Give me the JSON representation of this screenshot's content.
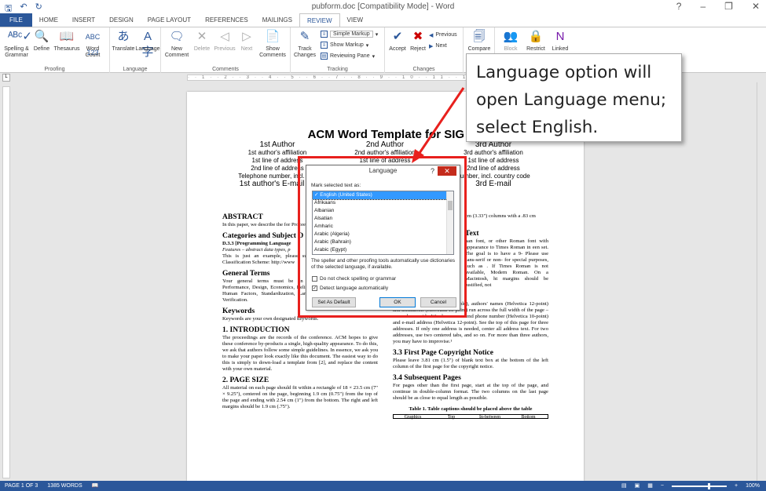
{
  "window": {
    "title": "pubform.doc [Compatibility Mode] - Word",
    "controls": [
      "?",
      "–",
      "❐",
      "✕"
    ]
  },
  "quick_access": {
    "save_icon": "save-icon",
    "undo_icon": "undo-icon",
    "redo_icon": "redo-icon"
  },
  "tabs": [
    "FILE",
    "HOME",
    "INSERT",
    "DESIGN",
    "PAGE LAYOUT",
    "REFERENCES",
    "MAILINGS",
    "REVIEW",
    "VIEW"
  ],
  "active_tab": "REVIEW",
  "ribbon": {
    "proofing": {
      "label": "Proofing",
      "spelling": "Spelling &\nGrammar",
      "define": "Define",
      "thesaurus": "Thesaurus",
      "word_count": "Word\nCount"
    },
    "language": {
      "label": "Language",
      "translate": "Translate",
      "language": "Language"
    },
    "comments": {
      "label": "Comments",
      "new": "New\nComment",
      "delete": "Delete",
      "previous": "Previous",
      "next": "Next",
      "show": "Show\nComments"
    },
    "tracking": {
      "label": "Tracking",
      "track": "Track\nChanges",
      "markup": "Simple Markup",
      "show_markup": "Show Markup",
      "reviewing_pane": "Reviewing Pane"
    },
    "changes": {
      "label": "Changes",
      "accept": "Accept",
      "reject": "Reject",
      "previous": "Previous",
      "next": "Next"
    },
    "compare": {
      "label": "Compare"
    },
    "protect": {
      "block": "Block",
      "restrict": "Restrict"
    },
    "onenote": {
      "linked": "Linked"
    }
  },
  "document": {
    "title": "ACM Word Template for SIG Si",
    "authors": [
      {
        "name": "1st Author",
        "lines": [
          "1st author's affiliation",
          "1st line of address",
          "2nd line of address",
          "Telephone number, incl. cou"
        ],
        "email": "1st author's E-mail ad"
      },
      {
        "name": "2nd Author",
        "lines": [
          "2nd author's affiliation",
          "1st line of address",
          "",
          ""
        ],
        "email": ""
      },
      {
        "name": "3rd Author",
        "lines": [
          "3rd author's affiliation",
          "1st line of address",
          "2nd line of address",
          "number, incl. country code"
        ],
        "email": "3rd E-mail"
      }
    ],
    "left_col": {
      "abstract_h": "ABSTRACT",
      "abstract_p": "In this paper, we describe the for Proceedings.",
      "cat_h": "Categories and Subject D",
      "cat_p1": "D.3.3 [Programming Language",
      "cat_p2": "Features – abstract data types, p",
      "cat_p3": "This is just an example, please subject descriptors for your sub Classification Scheme: http://www",
      "gen_h": "General Terms",
      "gen_p": "Your general terms must be an terms: Algorithms, Manageme Performance, Design, Economics, Reliability, Experimentation, Security, Human Factors, Standardization, Languages, Theory, Legal Aspects, Verification.",
      "kw_h": "Keywords",
      "kw_p": "Keywords are your own designated keywords.",
      "intro_h": "1.  INTRODUCTION",
      "intro_p": "The proceedings are the records of the conference. ACM hopes to give these conference by-products a single, high-quality appearance. To do this, we ask that authors follow some simple guidelines. In essence, we ask you to make your paper look exactly like this document. The easiest way to do this is simply to down-load a template from [2], and replace the content with your own material.",
      "size_h": "2.  PAGE SIZE",
      "size_p": "All material on each page should fit within a rectangle of 18 × 23.5 cm (7\" × 9.25\"), centered on the page, beginning 1.9 cm (0.75\") from the top of the page and ending with 2.54 cm (1\") from the bottom. The right and left margins should be 1.9 cm (.75\")."
    },
    "right_col": {
      "frag1": "cm (3.33\") columns with a .83 cm",
      "frag_h": "Text",
      "frag2": "nan font, or other Roman font with appearance to Times Roman in een set. The goal is to have a 9- Please use sans-serif or non- for special purposes, such as . If Times Roman is not available, Modern Roman. On a Macintosh, ht margins should be justified, not",
      "s32_h": "3.2  Title and Authors",
      "s32_p": "The title (Helvetica 18-point bold), authors' names (Helvetica 12-point) and affiliations (Helvetica 10-point) run across the full width of the page – one column wide. We also recommend phone number (Helvetica 10-point) and e-mail address (Helvetica 12-point). See the top of this page for three addresses. If only one address is needed, center all address text. For two addresses, use two centered tabs, and so on. For more than three authors, you may have to improvise.¹",
      "s33_h": "3.3  First Page Copyright Notice",
      "s33_p": "Please leave 3.81 cm (1.5\") of blank text box at the bottom of the left column of the first page for the copyright notice.",
      "s34_h": "3.4  Subsequent Pages",
      "s34_p": "For pages other than the first page, start at the top of the page, and continue in double-column format.  The two columns on the last page should be as close to equal length as possible.",
      "caption": "Table 1. Table captions should be placed above the table",
      "table_headers": [
        "Graphics",
        "Top",
        "In-between",
        "Bottom"
      ]
    }
  },
  "dialog": {
    "title": "Language",
    "help": "?",
    "close": "✕",
    "mark_label": "Mark selected text as:",
    "languages": [
      "English (United States)",
      "Afrikaans",
      "Albanian",
      "Alsatian",
      "Amharic",
      "Arabic (Algeria)",
      "Arabic (Bahrain)",
      "Arabic (Egypt)"
    ],
    "selected": "English (United States)",
    "note": "The speller and other proofing tools automatically use dictionaries of the selected language, if available.",
    "check_spelling": "Do not check spelling or grammar",
    "detect": "Detect language automatically",
    "detect_checked": true,
    "set_default": "Set As Default",
    "ok": "OK",
    "cancel": "Cancel"
  },
  "callout": {
    "text": "Language option will open Language menu; select English."
  },
  "status": {
    "page": "PAGE 1 OF 3",
    "words": "1385 WORDS",
    "zoom": "100%",
    "zoom_level": 1.0
  },
  "colors": {
    "accent": "#2b579a",
    "highlight": "#e8201d"
  }
}
